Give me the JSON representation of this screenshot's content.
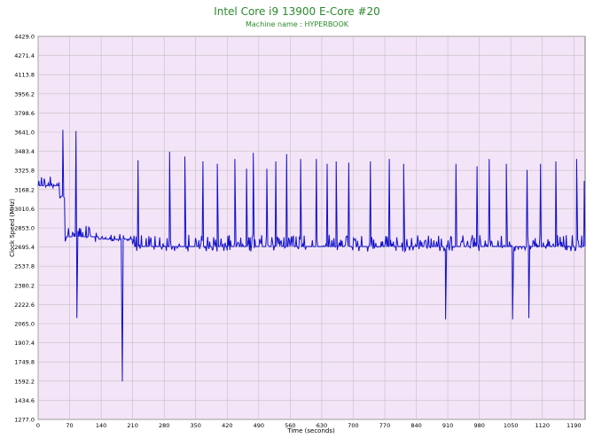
{
  "chart_data": {
    "type": "line",
    "title": "Intel Core i9 13900 E-Core #20",
    "subtitle": "Machine name : HYPERBOOK",
    "xlabel": "Time (seconds)",
    "ylabel": "Clock Speed (MHz)",
    "xlim": [
      0,
      1215
    ],
    "ylim": [
      1277.0,
      4429.0
    ],
    "x_ticks": [
      "0",
      "70",
      "140",
      "210",
      "280",
      "350",
      "420",
      "490",
      "560",
      "630",
      "700",
      "770",
      "840",
      "910",
      "980",
      "1050",
      "1120",
      "1190"
    ],
    "y_ticks": [
      "4429.0",
      "4271.4",
      "4113.8",
      "3956.2",
      "3798.6",
      "3641.0",
      "3483.4",
      "3325.8",
      "3168.2",
      "3010.6",
      "2853.0",
      "2695.4",
      "2537.8",
      "2380.2",
      "2222.6",
      "2065.0",
      "1907.4",
      "1749.8",
      "1592.2",
      "1434.6",
      "1277.0"
    ],
    "grid": true,
    "colors": {
      "line": "#1010c8",
      "plot_background": "#f4e4f8",
      "title": "#2a8a2a",
      "grid": "#c0c0c0"
    },
    "series": [
      {
        "base": 2700,
        "segments": [
          {
            "x0": 0,
            "x1": 48,
            "level": 3200,
            "noise": 60
          },
          {
            "x0": 48,
            "x1": 60,
            "level": 3100,
            "noise": 20
          },
          {
            "x0": 60,
            "x1": 135,
            "level": 2780,
            "noise": 70
          },
          {
            "x0": 135,
            "x1": 210,
            "level": 2760,
            "noise": 30
          },
          {
            "x0": 210,
            "x1": 1215,
            "level": 2700,
            "noise": 70
          }
        ],
        "spikes": [
          {
            "x": 55,
            "y": 3660
          },
          {
            "x": 84,
            "y": 3650
          },
          {
            "x": 86,
            "y": 2110
          },
          {
            "x": 187,
            "y": 1590
          },
          {
            "x": 186,
            "y": 2040
          },
          {
            "x": 222,
            "y": 3410
          },
          {
            "x": 292,
            "y": 3480
          },
          {
            "x": 326,
            "y": 3440
          },
          {
            "x": 366,
            "y": 3400
          },
          {
            "x": 398,
            "y": 3380
          },
          {
            "x": 437,
            "y": 3420
          },
          {
            "x": 463,
            "y": 3340
          },
          {
            "x": 478,
            "y": 3470
          },
          {
            "x": 508,
            "y": 3340
          },
          {
            "x": 528,
            "y": 3400
          },
          {
            "x": 552,
            "y": 3460
          },
          {
            "x": 583,
            "y": 3420
          },
          {
            "x": 618,
            "y": 3420
          },
          {
            "x": 642,
            "y": 3380
          },
          {
            "x": 662,
            "y": 3400
          },
          {
            "x": 690,
            "y": 3390
          },
          {
            "x": 738,
            "y": 3400
          },
          {
            "x": 780,
            "y": 3420
          },
          {
            "x": 812,
            "y": 3380
          },
          {
            "x": 905,
            "y": 2100
          },
          {
            "x": 928,
            "y": 3380
          },
          {
            "x": 975,
            "y": 3360
          },
          {
            "x": 1002,
            "y": 3420
          },
          {
            "x": 1040,
            "y": 3380
          },
          {
            "x": 1054,
            "y": 2100
          },
          {
            "x": 1086,
            "y": 3330
          },
          {
            "x": 1090,
            "y": 2110
          },
          {
            "x": 1116,
            "y": 3380
          },
          {
            "x": 1150,
            "y": 3400
          },
          {
            "x": 1196,
            "y": 3420
          },
          {
            "x": 1213,
            "y": 3240
          }
        ]
      }
    ]
  }
}
